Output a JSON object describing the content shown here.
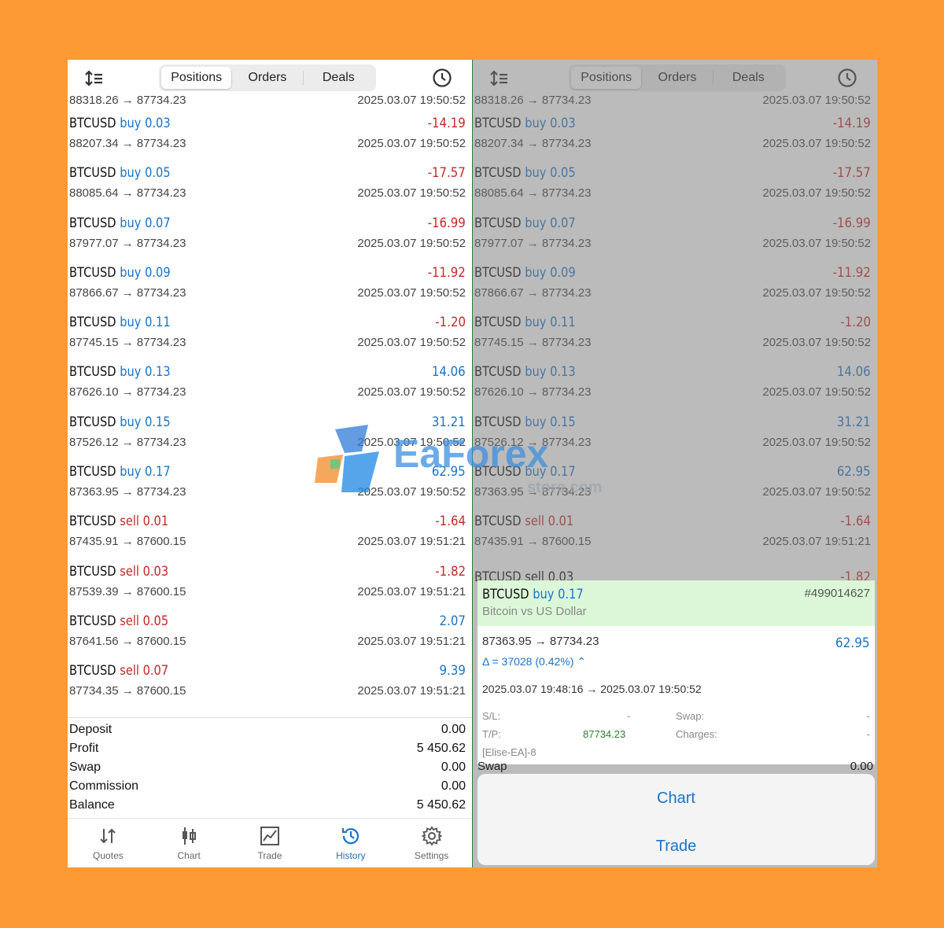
{
  "tabs": [
    "Positions",
    "Orders",
    "Deals"
  ],
  "active_tab": "Positions",
  "partial_row": {
    "prices": "88318.26 → 87734.23",
    "time": "2025.03.07 19:50:52"
  },
  "deals": [
    {
      "symbol": "BTCUSD",
      "side": "buy",
      "volume": "0.03",
      "profit": "-14.19",
      "prices": "88207.34 → 87734.23",
      "time": "2025.03.07 19:50:52"
    },
    {
      "symbol": "BTCUSD",
      "side": "buy",
      "volume": "0.05",
      "profit": "-17.57",
      "prices": "88085.64 → 87734.23",
      "time": "2025.03.07 19:50:52"
    },
    {
      "symbol": "BTCUSD",
      "side": "buy",
      "volume": "0.07",
      "profit": "-16.99",
      "prices": "87977.07 → 87734.23",
      "time": "2025.03.07 19:50:52"
    },
    {
      "symbol": "BTCUSD",
      "side": "buy",
      "volume": "0.09",
      "profit": "-11.92",
      "prices": "87866.67 → 87734.23",
      "time": "2025.03.07 19:50:52"
    },
    {
      "symbol": "BTCUSD",
      "side": "buy",
      "volume": "0.11",
      "profit": "-1.20",
      "prices": "87745.15 → 87734.23",
      "time": "2025.03.07 19:50:52"
    },
    {
      "symbol": "BTCUSD",
      "side": "buy",
      "volume": "0.13",
      "profit": "14.06",
      "prices": "87626.10 → 87734.23",
      "time": "2025.03.07 19:50:52"
    },
    {
      "symbol": "BTCUSD",
      "side": "buy",
      "volume": "0.15",
      "profit": "31.21",
      "prices": "87526.12 → 87734.23",
      "time": "2025.03.07 19:50:52"
    },
    {
      "symbol": "BTCUSD",
      "side": "buy",
      "volume": "0.17",
      "profit": "62.95",
      "prices": "87363.95 → 87734.23",
      "time": "2025.03.07 19:50:52"
    },
    {
      "symbol": "BTCUSD",
      "side": "sell",
      "volume": "0.01",
      "profit": "-1.64",
      "prices": "87435.91 → 87600.15",
      "time": "2025.03.07 19:51:21"
    },
    {
      "symbol": "BTCUSD",
      "side": "sell",
      "volume": "0.03",
      "profit": "-1.82",
      "prices": "87539.39 → 87600.15",
      "time": "2025.03.07 19:51:21"
    },
    {
      "symbol": "BTCUSD",
      "side": "sell",
      "volume": "0.05",
      "profit": "2.07",
      "prices": "87641.56 → 87600.15",
      "time": "2025.03.07 19:51:21"
    },
    {
      "symbol": "BTCUSD",
      "side": "sell",
      "volume": "0.07",
      "profit": "9.39",
      "prices": "87734.35 → 87600.15",
      "time": "2025.03.07 19:51:21"
    }
  ],
  "summary": [
    {
      "label": "Deposit",
      "value": "0.00"
    },
    {
      "label": "Profit",
      "value": "5 450.62"
    },
    {
      "label": "Swap",
      "value": "0.00"
    },
    {
      "label": "Commission",
      "value": "0.00"
    },
    {
      "label": "Balance",
      "value": "5 450.62"
    }
  ],
  "bottom_nav": [
    {
      "label": "Quotes",
      "icon": "quotes-icon"
    },
    {
      "label": "Chart",
      "icon": "chart-icon"
    },
    {
      "label": "Trade",
      "icon": "trade-icon"
    },
    {
      "label": "History",
      "icon": "history-icon"
    },
    {
      "label": "Settings",
      "icon": "settings-icon"
    }
  ],
  "active_nav": "History",
  "right_partial_label": "BTCUSD sell 0.03",
  "right_partial_profit": "-1.82",
  "detail": {
    "symbol": "BTCUSD",
    "side": "buy",
    "volume": "0.17",
    "ticket": "#499014627",
    "description": "Bitcoin vs US Dollar",
    "prices": "87363.95 → 87734.23",
    "profit": "62.95",
    "delta": "Δ = 37028 (0.42%) ⌃",
    "times": "2025.03.07 19:48:16 → 2025.03.07 19:50:52",
    "sl_label": "S/L:",
    "sl_value": "-",
    "tp_label": "T/P:",
    "tp_value": "87734.23",
    "swap_label": "Swap:",
    "swap_value": "-",
    "charges_label": "Charges:",
    "charges_value": "-",
    "comment": "[Elise-EA]-8"
  },
  "behind_swap": {
    "label": "Swap",
    "value": "0.00"
  },
  "actions": {
    "chart": "Chart",
    "trade": "Trade"
  },
  "watermark": {
    "brand": "EaForex",
    "domain": "store.com"
  },
  "colors": {
    "background": "#FD9A33",
    "buy": "#1a73c8",
    "sell": "#c62828",
    "profit_positive": "#1a73c8",
    "profit_negative": "#c62828",
    "detail_header": "#dcf7d8"
  }
}
